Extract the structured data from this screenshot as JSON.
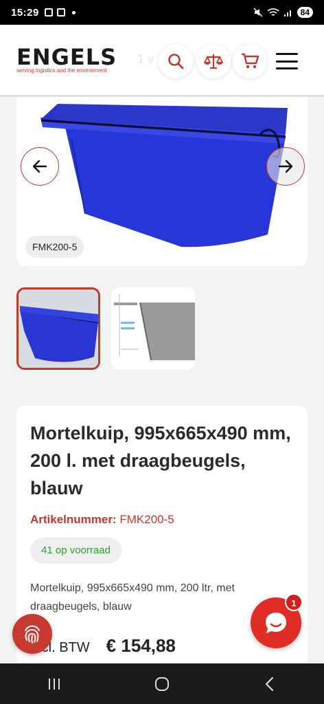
{
  "status_bar": {
    "time": "15:29",
    "battery": "84"
  },
  "header": {
    "logo_text": "ENGELS",
    "logo_tagline": "serving logistics and the environment",
    "faded_text": "1 v",
    "icons": [
      "search-icon",
      "scale-compare-icon",
      "cart-icon",
      "hamburger-menu-icon"
    ]
  },
  "gallery": {
    "sku_chip": "FMK200-5",
    "thumbnails": [
      "blue-tub-thumbnail",
      "technical-drawing-thumbnail"
    ]
  },
  "product": {
    "title": "Mortelkuip, 995x665x490 mm, 200 l. met draagbeugels, blauw",
    "article_label": "Artikelnummer:",
    "article_number": "FMK200-5",
    "stock": "41 op voorraad",
    "description": "Mortelkuip, 995x665x490 mm, 200 ltr, met draagbeugels, blauw",
    "price_label": "Incl. BTW",
    "price": "€ 154,88"
  },
  "chat": {
    "badge_count": "1"
  },
  "colors": {
    "brand_red": "#c0392b",
    "tub_blue": "#2433d6",
    "stock_green": "#2e9e2e"
  }
}
